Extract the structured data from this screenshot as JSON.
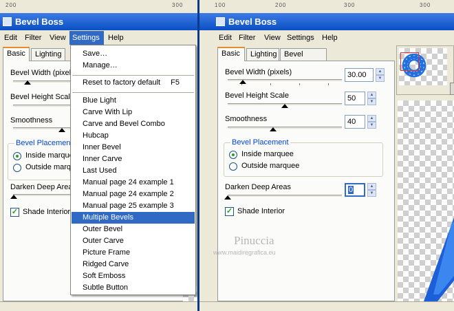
{
  "left_window": {
    "title": "Bevel Boss",
    "menubar": [
      "Edit",
      "Filter",
      "View",
      "Settings",
      "Help"
    ],
    "tabs": [
      "Basic",
      "Lighting"
    ],
    "fields": {
      "bevel_width_label": "Bevel Width (pixel",
      "bevel_height_label": "Bevel Height Scale",
      "smoothness_label": "Smoothness",
      "bevel_placement_title": "Bevel Placemen",
      "inside_label": "Inside marque",
      "outside_label": "Outside marqu",
      "darken_label": "Darken Deep Area",
      "shade_label": "Shade Interior"
    }
  },
  "settings_menu": {
    "items_top": [
      "Save…",
      "Manage…"
    ],
    "reset": {
      "label": "Reset to factory default",
      "shortcut": "F5"
    },
    "presets": [
      "Blue Light",
      "Carve With Lip",
      "Carve and Bevel Combo",
      "Hubcap",
      "Inner Bevel",
      "Inner Carve",
      "Last Used",
      "Manual page 24 example 1",
      "Manual page 24 example 2",
      "Manual page 25 example 3",
      "Multiple Bevels",
      "Outer Bevel",
      "Outer Carve",
      "Picture Frame",
      "Ridged Carve",
      "Soft Emboss",
      "Subtle Button"
    ],
    "highlighted": "Multiple Bevels"
  },
  "right_window": {
    "title": "Bevel Boss",
    "menubar": [
      "Edit",
      "Filter",
      "View",
      "Settings",
      "Help"
    ],
    "tabs": [
      "Basic",
      "Lighting",
      "Bevel Profile"
    ],
    "bevel_width": {
      "label": "Bevel Width (pixels)",
      "value": "30.00",
      "slider": 0.13
    },
    "bevel_height": {
      "label": "Bevel Height Scale",
      "value": "50",
      "slider": 0.5
    },
    "smoothness": {
      "label": "Smoothness",
      "value": "40",
      "slider": 0.4
    },
    "bevel_placement": {
      "title": "Bevel Placement",
      "inside": "Inside marquee",
      "outside": "Outside marquee",
      "selected": "inside"
    },
    "darken_deep_areas": {
      "label": "Darken Deep Areas",
      "value": "0",
      "slider": 0.0
    },
    "shade_interior": {
      "label": "Shade Interior",
      "checked": true
    }
  },
  "watermark": {
    "name": "Pinuccia",
    "url": "www.maidiregrafica.eu"
  },
  "colors": {
    "titlebar": "#0a4fc4",
    "menu_highlight": "#316ac5",
    "tab_accent": "#e68b2c",
    "group_title": "#0046d5",
    "preview_blue": "#1f6fe0"
  }
}
